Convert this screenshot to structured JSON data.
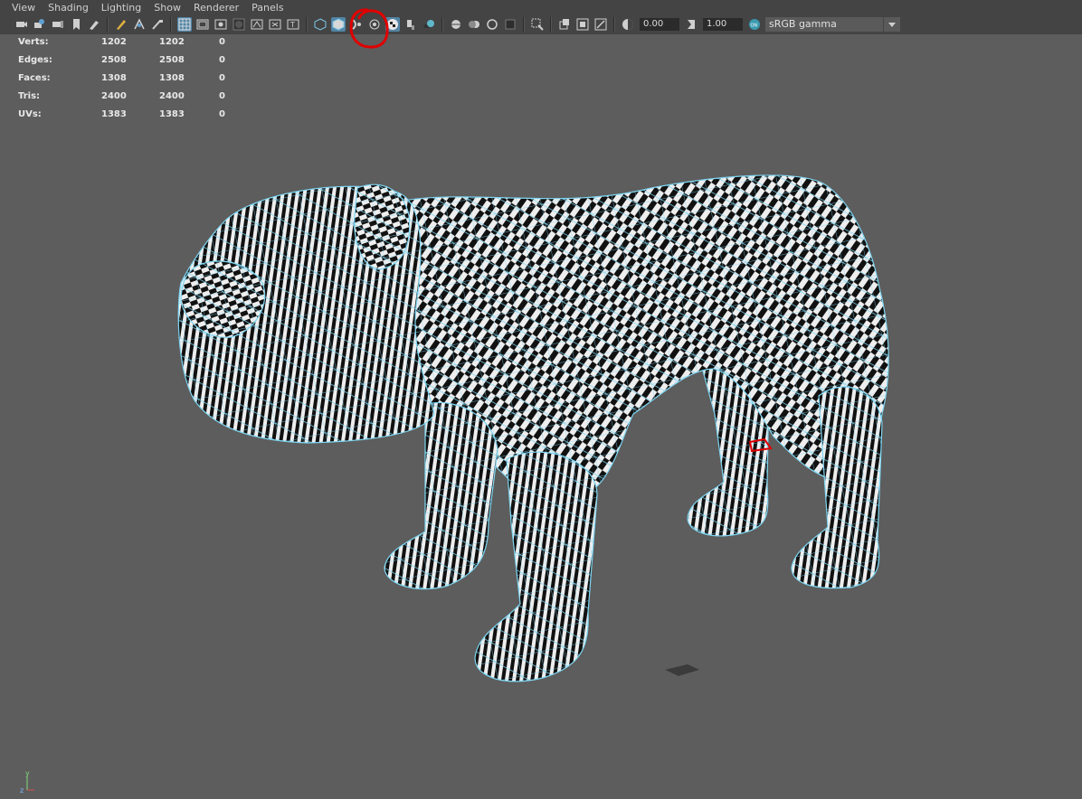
{
  "menubar": {
    "items": [
      "View",
      "Shading",
      "Lighting",
      "Show",
      "Renderer",
      "Panels"
    ]
  },
  "toolbar": {
    "exposure_value": "0.00",
    "gamma_value": "1.00",
    "color_space": "sRGB gamma",
    "accent_active": "#5285a6"
  },
  "hud": {
    "rows": [
      {
        "label": "Verts:",
        "v1": "1202",
        "v2": "1202",
        "v3": "0"
      },
      {
        "label": "Edges:",
        "v1": "2508",
        "v2": "2508",
        "v3": "0"
      },
      {
        "label": "Faces:",
        "v1": "1308",
        "v2": "1308",
        "v3": "0"
      },
      {
        "label": "Tris:",
        "v1": "2400",
        "v2": "2400",
        "v3": "0"
      },
      {
        "label": "UVs:",
        "v1": "1383",
        "v2": "1383",
        "v3": "0"
      }
    ]
  },
  "viewport": {
    "background": "#5d5d5d",
    "wireframe_color": "#7fd6f2",
    "model": "bulldog-checker-mesh"
  },
  "annotation": {
    "color": "#e00000"
  },
  "axis": {
    "y_label": "y",
    "z_label": "z"
  }
}
